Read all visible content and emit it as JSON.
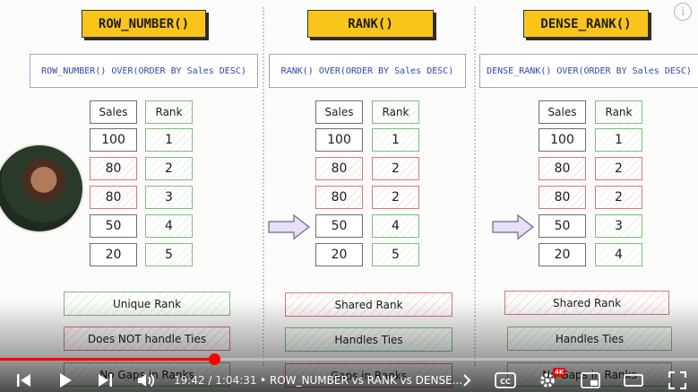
{
  "panels": [
    {
      "title": "ROW_NUMBER()",
      "sql": "ROW_NUMBER() OVER(ORDER BY Sales DESC)",
      "headers": [
        "Sales",
        "Rank"
      ],
      "rows": [
        [
          "100",
          "1"
        ],
        [
          "80",
          "2"
        ],
        [
          "80",
          "3"
        ],
        [
          "50",
          "4"
        ],
        [
          "20",
          "5"
        ]
      ],
      "properties": [
        "Unique Rank",
        "Does NOT handle Ties",
        "No Gaps in Ranks"
      ]
    },
    {
      "title": "RANK()",
      "sql": "RANK() OVER(ORDER BY Sales DESC)",
      "headers": [
        "Sales",
        "Rank"
      ],
      "rows": [
        [
          "100",
          "1"
        ],
        [
          "80",
          "2"
        ],
        [
          "80",
          "2"
        ],
        [
          "50",
          "4"
        ],
        [
          "20",
          "5"
        ]
      ],
      "properties": [
        "Shared Rank",
        "Handles Ties",
        "Gaps in Ranks"
      ]
    },
    {
      "title": "DENSE_RANK()",
      "sql": "DENSE_RANK() OVER(ORDER BY Sales DESC)",
      "headers": [
        "Sales",
        "Rank"
      ],
      "rows": [
        [
          "100",
          "1"
        ],
        [
          "80",
          "2"
        ],
        [
          "80",
          "2"
        ],
        [
          "50",
          "3"
        ],
        [
          "20",
          "4"
        ]
      ],
      "properties": [
        "Shared Rank",
        "Handles Ties",
        "No Gaps in Ranks"
      ]
    }
  ],
  "player": {
    "current_time": "19:42",
    "duration": "1:04:31",
    "time_display": "19:42 / 1:04:31",
    "chapter": "• ROW_NUMBER vs RANK vs DENSE...",
    "progress": 0.308,
    "quality_badge": "4K",
    "info_glyph": "i",
    "icons": [
      "skip-previous-icon",
      "play-icon",
      "skip-next-icon",
      "volume-icon",
      "chevron-right-icon",
      "captions-icon",
      "settings-gear-icon",
      "miniplayer-icon",
      "theater-mode-icon",
      "fullscreen-icon"
    ]
  },
  "colors": {
    "title_fill": "#f9c51b",
    "sql_text": "#2f49a8",
    "green_border": "#7cbf7c",
    "red_border": "#d67a7a",
    "progress_red": "#ff0000"
  }
}
